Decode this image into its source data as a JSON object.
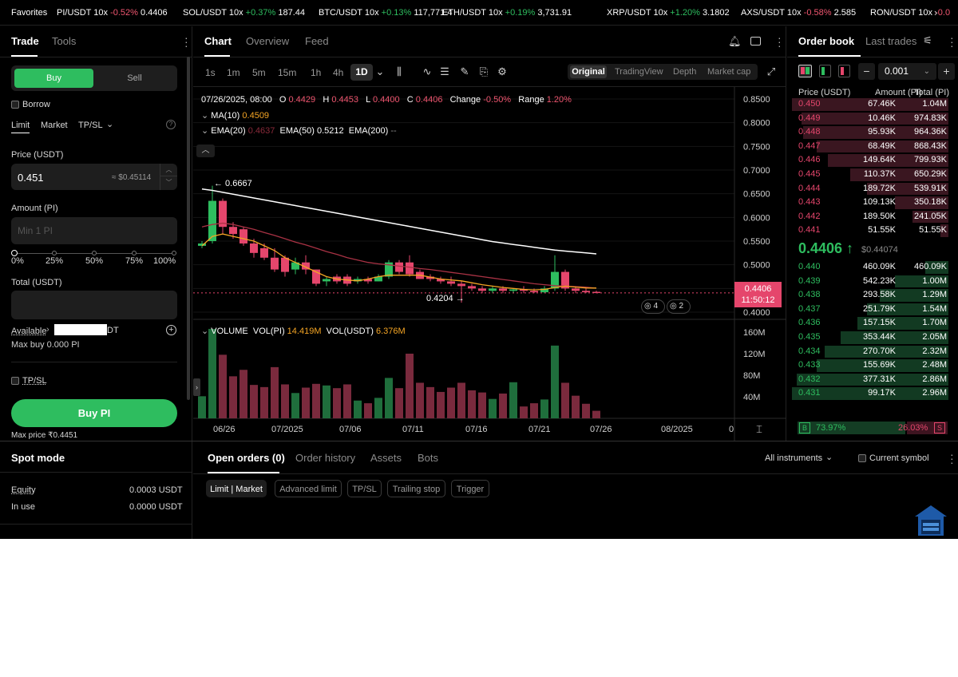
{
  "ticker": {
    "favorites_label": "Favorites",
    "items": [
      {
        "pair": "PI/USDT 10x",
        "change": "-0.52%",
        "price": "0.4406",
        "dir": "neg"
      },
      {
        "pair": "SOL/USDT 10x",
        "change": "+0.37%",
        "price": "187.44",
        "dir": "pos"
      },
      {
        "pair": "BTC/USDT 10x",
        "change": "+0.13%",
        "price": "117,771.4",
        "dir": "pos"
      },
      {
        "pair": "ETH/USDT 10x",
        "change": "+0.19%",
        "price": "3,731.91",
        "dir": "pos"
      },
      {
        "pair": "XRP/USDT 10x",
        "change": "+1.20%",
        "price": "3.1802",
        "dir": "pos"
      },
      {
        "pair": "AXS/USDT 10x",
        "change": "-0.58%",
        "price": "2.585",
        "dir": "neg"
      },
      {
        "pair": "RON/USDT 10x",
        "change": "-0.0",
        "price": "",
        "dir": "neg"
      }
    ],
    "next_icon": "chevron-right-icon"
  },
  "trade": {
    "tabs": [
      "Trade",
      "Tools"
    ],
    "buy_label": "Buy",
    "sell_label": "Sell",
    "borrow_label": "Borrow",
    "order_types": [
      "Limit",
      "Market",
      "TP/SL"
    ],
    "price_label": "Price (USDT)",
    "price_value": "0.451",
    "price_approx": "≈ $0.45114",
    "amount_label": "Amount (PI)",
    "amount_placeholder": "Min 1 PI",
    "slider_marks": [
      "0%",
      "25%",
      "50%",
      "75%",
      "100%"
    ],
    "total_label": "Total (USDT)",
    "available_label": "Available",
    "available_suffix": "DT",
    "max_buy": "Max buy 0.000 PI",
    "tpsl_label": "TP/SL",
    "buy_button": "Buy PI",
    "max_price": "Max price ₹0.4451"
  },
  "spot": {
    "title": "Spot mode",
    "equity_label": "Equity",
    "equity_value": "0.0003 USDT",
    "inuse_label": "In use",
    "inuse_value": "0.0000 USDT"
  },
  "chart_tabs": [
    "Chart",
    "Overview",
    "Feed"
  ],
  "timeframes": [
    "1s",
    "1m",
    "5m",
    "15m",
    "1h",
    "4h",
    "1D"
  ],
  "views": [
    "Original",
    "TradingView",
    "Depth",
    "Market cap"
  ],
  "legend": {
    "date": "07/26/2025, 08:00",
    "o_label": "O",
    "o": "0.4429",
    "h_label": "H",
    "h": "0.4453",
    "l_label": "L",
    "l": "0.4400",
    "c_label": "C",
    "c": "0.4406",
    "change_label": "Change",
    "change": "-0.50%",
    "range_label": "Range",
    "range": "1.20%",
    "ma_label": "MA(10)",
    "ma": "0.4509",
    "ema20_label": "EMA(20)",
    "ema20": "0.4637",
    "ema50_label": "EMA(50)",
    "ema50": "0.5212",
    "ema200_label": "EMA(200)",
    "ema200": "--",
    "high_marker": "← 0.6667",
    "low_marker": "0.4204 →",
    "badge_a": "4",
    "badge_b": "2",
    "last_price": "0.4406",
    "countdown": "11:50:12"
  },
  "volume_legend": {
    "label": "VOLUME",
    "vol_pi_label": "VOL(PI)",
    "vol_pi": "14.419M",
    "vol_usdt_label": "VOL(USDT)",
    "vol_usdt": "6.376M"
  },
  "chart_data": {
    "type": "candlestick",
    "price_axis": [
      "0.8500",
      "0.8000",
      "0.7500",
      "0.7000",
      "0.6500",
      "0.6000",
      "0.5500",
      "0.5000",
      "0.4500",
      "0.4000"
    ],
    "volume_axis": [
      "160M",
      "120M",
      "80M",
      "40M"
    ],
    "date_axis": [
      "06/26",
      "07/2025",
      "07/06",
      "07/11",
      "07/16",
      "07/21",
      "07/26",
      "08/2025",
      "0"
    ],
    "candles": [
      {
        "o": 0.54,
        "h": 0.55,
        "l": 0.535,
        "c": 0.545,
        "v": 41
      },
      {
        "o": 0.55,
        "h": 0.667,
        "l": 0.545,
        "c": 0.635,
        "v": 166
      },
      {
        "o": 0.635,
        "h": 0.64,
        "l": 0.565,
        "c": 0.58,
        "v": 118
      },
      {
        "o": 0.58,
        "h": 0.59,
        "l": 0.555,
        "c": 0.565,
        "v": 78
      },
      {
        "o": 0.575,
        "h": 0.58,
        "l": 0.54,
        "c": 0.545,
        "v": 90
      },
      {
        "o": 0.545,
        "h": 0.555,
        "l": 0.515,
        "c": 0.525,
        "v": 62
      },
      {
        "o": 0.535,
        "h": 0.545,
        "l": 0.51,
        "c": 0.515,
        "v": 58
      },
      {
        "o": 0.515,
        "h": 0.535,
        "l": 0.485,
        "c": 0.49,
        "v": 95
      },
      {
        "o": 0.515,
        "h": 0.52,
        "l": 0.475,
        "c": 0.485,
        "v": 63
      },
      {
        "o": 0.49,
        "h": 0.515,
        "l": 0.48,
        "c": 0.505,
        "v": 47
      },
      {
        "o": 0.505,
        "h": 0.52,
        "l": 0.48,
        "c": 0.49,
        "v": 57
      },
      {
        "o": 0.49,
        "h": 0.49,
        "l": 0.455,
        "c": 0.46,
        "v": 64
      },
      {
        "o": 0.465,
        "h": 0.475,
        "l": 0.455,
        "c": 0.47,
        "v": 61
      },
      {
        "o": 0.475,
        "h": 0.48,
        "l": 0.46,
        "c": 0.465,
        "v": 56
      },
      {
        "o": 0.475,
        "h": 0.48,
        "l": 0.455,
        "c": 0.46,
        "v": 63
      },
      {
        "o": 0.465,
        "h": 0.475,
        "l": 0.46,
        "c": 0.47,
        "v": 33
      },
      {
        "o": 0.47,
        "h": 0.475,
        "l": 0.46,
        "c": 0.465,
        "v": 28
      },
      {
        "o": 0.465,
        "h": 0.48,
        "l": 0.465,
        "c": 0.475,
        "v": 38
      },
      {
        "o": 0.475,
        "h": 0.51,
        "l": 0.47,
        "c": 0.505,
        "v": 75
      },
      {
        "o": 0.505,
        "h": 0.51,
        "l": 0.48,
        "c": 0.485,
        "v": 56
      },
      {
        "o": 0.505,
        "h": 0.52,
        "l": 0.475,
        "c": 0.48,
        "v": 120
      },
      {
        "o": 0.485,
        "h": 0.49,
        "l": 0.47,
        "c": 0.47,
        "v": 66
      },
      {
        "o": 0.475,
        "h": 0.48,
        "l": 0.465,
        "c": 0.47,
        "v": 58
      },
      {
        "o": 0.47,
        "h": 0.475,
        "l": 0.46,
        "c": 0.465,
        "v": 49
      },
      {
        "o": 0.465,
        "h": 0.475,
        "l": 0.455,
        "c": 0.46,
        "v": 57
      },
      {
        "o": 0.46,
        "h": 0.465,
        "l": 0.42,
        "c": 0.455,
        "v": 66
      },
      {
        "o": 0.455,
        "h": 0.46,
        "l": 0.445,
        "c": 0.45,
        "v": 52
      },
      {
        "o": 0.45,
        "h": 0.455,
        "l": 0.44,
        "c": 0.445,
        "v": 48
      },
      {
        "o": 0.445,
        "h": 0.455,
        "l": 0.44,
        "c": 0.45,
        "v": 36
      },
      {
        "o": 0.45,
        "h": 0.455,
        "l": 0.44,
        "c": 0.445,
        "v": 46
      },
      {
        "o": 0.445,
        "h": 0.45,
        "l": 0.44,
        "c": 0.448,
        "v": 67
      },
      {
        "o": 0.448,
        "h": 0.455,
        "l": 0.44,
        "c": 0.445,
        "v": 22
      },
      {
        "o": 0.445,
        "h": 0.45,
        "l": 0.44,
        "c": 0.442,
        "v": 28
      },
      {
        "o": 0.442,
        "h": 0.455,
        "l": 0.44,
        "c": 0.45,
        "v": 35
      },
      {
        "o": 0.45,
        "h": 0.52,
        "l": 0.445,
        "c": 0.485,
        "v": 135
      },
      {
        "o": 0.485,
        "h": 0.49,
        "l": 0.445,
        "c": 0.45,
        "v": 66
      },
      {
        "o": 0.45,
        "h": 0.455,
        "l": 0.44,
        "c": 0.445,
        "v": 42
      },
      {
        "o": 0.445,
        "h": 0.45,
        "l": 0.44,
        "c": 0.442,
        "v": 27
      },
      {
        "o": 0.4429,
        "h": 0.4453,
        "l": 0.44,
        "c": 0.4406,
        "v": 14
      }
    ],
    "ema200": [
      0.66,
      0.657,
      0.653,
      0.649,
      0.645,
      0.641,
      0.637,
      0.633,
      0.629,
      0.625,
      0.621,
      0.617,
      0.613,
      0.609,
      0.605,
      0.601,
      0.597,
      0.593,
      0.589,
      0.585,
      0.581,
      0.577,
      0.573,
      0.569,
      0.565,
      0.561,
      0.557,
      0.553,
      0.549,
      0.546,
      0.543,
      0.54,
      0.537,
      0.534,
      0.531,
      0.529,
      0.527,
      0.525,
      0.523
    ],
    "ema50": [
      0.58,
      0.585,
      0.588,
      0.585,
      0.58,
      0.575,
      0.568,
      0.562,
      0.555,
      0.548,
      0.542,
      0.535,
      0.528,
      0.522,
      0.515,
      0.51,
      0.505,
      0.502,
      0.5,
      0.497,
      0.495,
      0.492,
      0.49,
      0.487,
      0.484,
      0.481,
      0.478,
      0.475,
      0.472,
      0.469,
      0.466,
      0.463,
      0.46,
      0.458,
      0.456,
      0.455,
      0.454,
      0.453,
      0.4505
    ],
    "ma10": [
      0.54,
      0.56,
      0.565,
      0.56,
      0.555,
      0.55,
      0.54,
      0.53,
      0.515,
      0.505,
      0.495,
      0.485,
      0.475,
      0.47,
      0.468,
      0.466,
      0.47,
      0.475,
      0.478,
      0.478,
      0.478,
      0.478,
      0.474,
      0.47,
      0.468,
      0.466,
      0.462,
      0.458,
      0.455,
      0.452,
      0.45,
      0.448,
      0.447,
      0.448,
      0.452,
      0.455,
      0.453,
      0.451,
      0.4509
    ]
  },
  "orderbook": {
    "tabs": [
      "Order book",
      "Last trades"
    ],
    "tick": "0.001",
    "headers": [
      "Price (USDT)",
      "Amount (PI)",
      "Total (PI)"
    ],
    "asks": [
      {
        "p": "0.450",
        "a": "67.46K",
        "t": "1.04M",
        "d": 1.0
      },
      {
        "p": "0.449",
        "a": "10.46K",
        "t": "974.83K",
        "d": 0.94
      },
      {
        "p": "0.448",
        "a": "95.93K",
        "t": "964.36K",
        "d": 0.93
      },
      {
        "p": "0.447",
        "a": "68.49K",
        "t": "868.43K",
        "d": 0.84
      },
      {
        "p": "0.446",
        "a": "149.64K",
        "t": "799.93K",
        "d": 0.77
      },
      {
        "p": "0.445",
        "a": "110.37K",
        "t": "650.29K",
        "d": 0.63
      },
      {
        "p": "0.444",
        "a": "189.72K",
        "t": "539.91K",
        "d": 0.52
      },
      {
        "p": "0.443",
        "a": "109.13K",
        "t": "350.18K",
        "d": 0.34
      },
      {
        "p": "0.442",
        "a": "189.50K",
        "t": "241.05K",
        "d": 0.23
      },
      {
        "p": "0.441",
        "a": "51.55K",
        "t": "51.55K",
        "d": 0.05
      }
    ],
    "mid_price": "0.4406 ↑",
    "mid_usd": "$0.44074",
    "bids": [
      {
        "p": "0.440",
        "a": "460.09K",
        "t": "460.09K",
        "d": 0.15
      },
      {
        "p": "0.439",
        "a": "542.23K",
        "t": "1.00M",
        "d": 0.34
      },
      {
        "p": "0.438",
        "a": "293.58K",
        "t": "1.29M",
        "d": 0.44
      },
      {
        "p": "0.437",
        "a": "251.79K",
        "t": "1.54M",
        "d": 0.52
      },
      {
        "p": "0.436",
        "a": "157.15K",
        "t": "1.70M",
        "d": 0.58
      },
      {
        "p": "0.435",
        "a": "353.44K",
        "t": "2.05M",
        "d": 0.69
      },
      {
        "p": "0.434",
        "a": "270.70K",
        "t": "2.32M",
        "d": 0.79
      },
      {
        "p": "0.433",
        "a": "155.69K",
        "t": "2.48M",
        "d": 0.84
      },
      {
        "p": "0.432",
        "a": "377.31K",
        "t": "2.86M",
        "d": 0.97
      },
      {
        "p": "0.431",
        "a": "99.17K",
        "t": "2.96M",
        "d": 1.0
      }
    ],
    "buy_ratio_label": "B",
    "buy_ratio": "73.97%",
    "sell_ratio": "26.03%",
    "sell_ratio_label": "S"
  },
  "orders": {
    "tabs": [
      "Open orders (0)",
      "Order history",
      "Assets",
      "Bots"
    ],
    "filter": "All instruments",
    "current_symbol": "Current symbol",
    "subtabs": [
      "Limit | Market",
      "Advanced limit",
      "TP/SL",
      "Trailing stop",
      "Trigger"
    ]
  },
  "colors": {
    "up": "#2ebd5f",
    "down": "#e5466c",
    "ema200": "#ffffff",
    "ema50": "#a83244",
    "ma10": "#f5a524",
    "bg": "#000000"
  }
}
